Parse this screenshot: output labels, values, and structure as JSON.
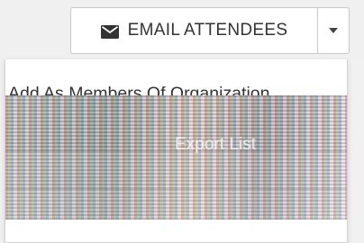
{
  "toolbar": {
    "email_button_label": "EMAIL ATTENDEES",
    "email_icon": "mail-icon",
    "dropdown_icon": "caret-down-icon"
  },
  "dropdown_menu": {
    "items": [
      {
        "label": "Add As Members Of Organization"
      },
      {
        "label": "Export List"
      }
    ]
  },
  "colors": {
    "button_bg": "#ffffff",
    "button_border": "#c9c9c9",
    "text": "#333333",
    "page_bg": "#f0f0f0"
  }
}
